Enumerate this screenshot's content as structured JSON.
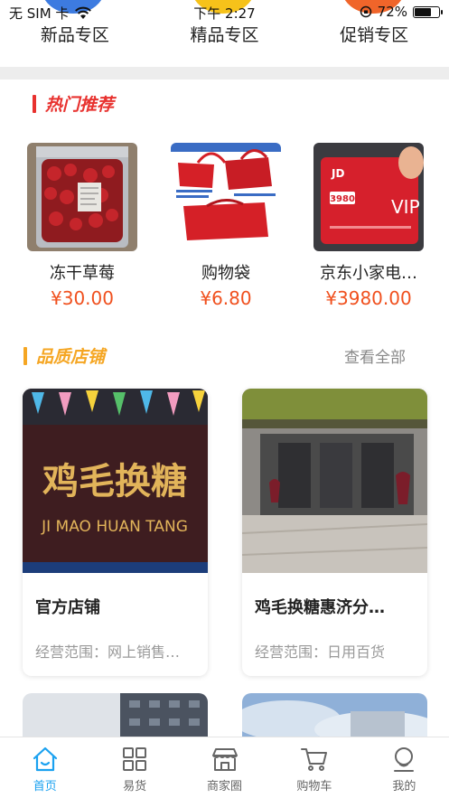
{
  "status_bar": {
    "carrier": "无 SIM 卡",
    "time": "下午 2:27",
    "battery_percent": "72%",
    "battery_level": 0.72
  },
  "categories": [
    {
      "label": "新品专区"
    },
    {
      "label": "精品专区"
    },
    {
      "label": "促销专区"
    }
  ],
  "hot_section": {
    "title": "热门推荐",
    "accent_color": "#e8322f"
  },
  "hot_products": [
    {
      "name": "冻干草莓",
      "price": "¥30.00",
      "image_text": ""
    },
    {
      "name": "购物袋",
      "price": "¥6.80",
      "image_text": ""
    },
    {
      "name": "京东小家电…",
      "price": "¥3980.00",
      "image_text": "VIP"
    }
  ],
  "shop_section": {
    "title": "品质店铺",
    "see_all": "查看全部",
    "accent_color": "#f5a623"
  },
  "shops": [
    {
      "name": "官方店铺",
      "scope": "经营范围：网上销售…",
      "image_text_cn": "鸡毛换糖",
      "image_text_en": "JI MAO HUAN TANG"
    },
    {
      "name": "鸡毛换糖惠济分…",
      "scope": "经营范围：日用百货"
    }
  ],
  "tab_bar": {
    "items": [
      {
        "label": "首页",
        "icon": "home-icon",
        "active": true
      },
      {
        "label": "易货",
        "icon": "grid-icon",
        "active": false
      },
      {
        "label": "商家圈",
        "icon": "store-icon",
        "active": false
      },
      {
        "label": "购物车",
        "icon": "cart-icon",
        "active": false
      },
      {
        "label": "我的",
        "icon": "profile-icon",
        "active": false
      }
    ],
    "active_color": "#1aa1f0"
  }
}
